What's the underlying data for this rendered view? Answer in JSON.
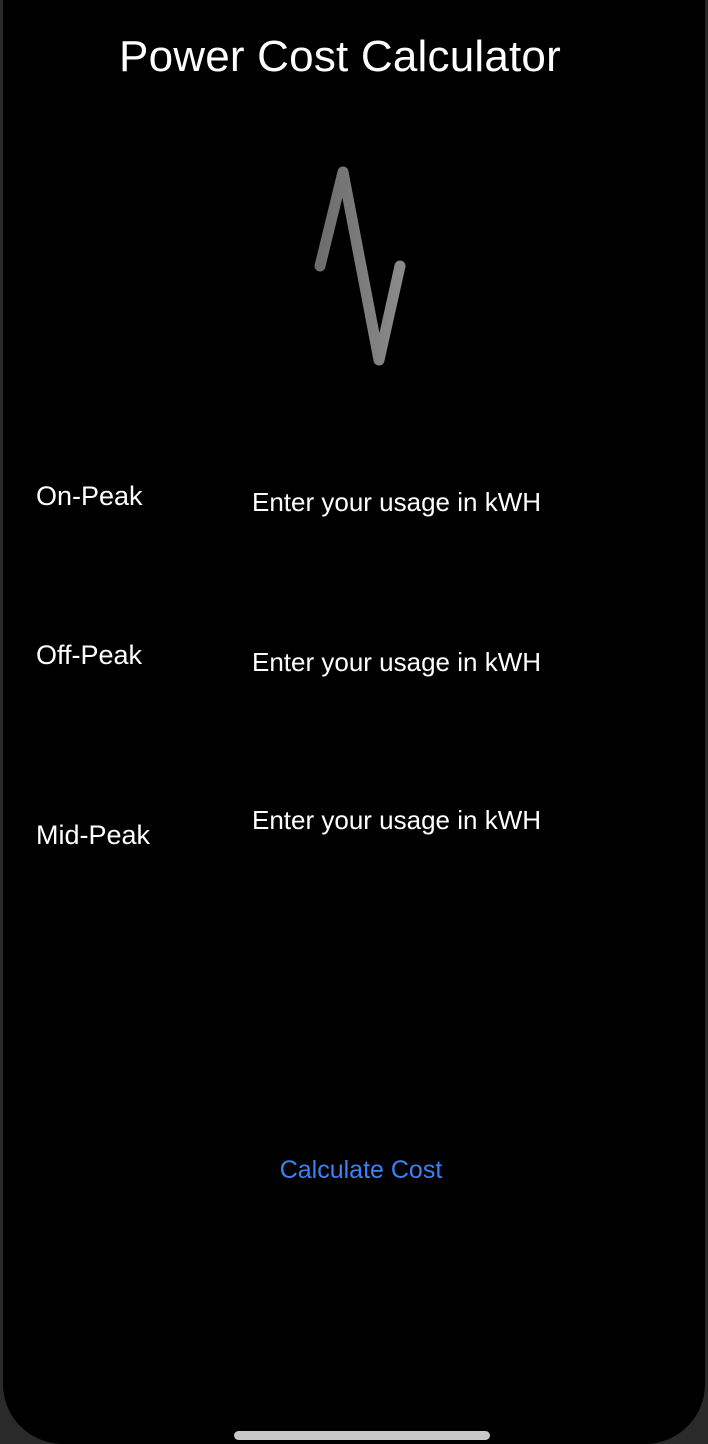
{
  "app": {
    "title": "Power Cost Calculator"
  },
  "icons": {
    "logo": "pulse-heartbeat-icon"
  },
  "form": {
    "rows": [
      {
        "label": "On-Peak",
        "placeholder": "Enter your usage in kWH",
        "value": ""
      },
      {
        "label": "Off-Peak",
        "placeholder": "Enter your usage in kWH",
        "value": ""
      },
      {
        "label": "Mid-Peak",
        "placeholder": "Enter your usage in kWH",
        "value": ""
      }
    ]
  },
  "actions": {
    "calculate_label": "Calculate Cost"
  },
  "colors": {
    "background": "#000000",
    "text": "#ffffff",
    "accent": "#3b82f6"
  }
}
